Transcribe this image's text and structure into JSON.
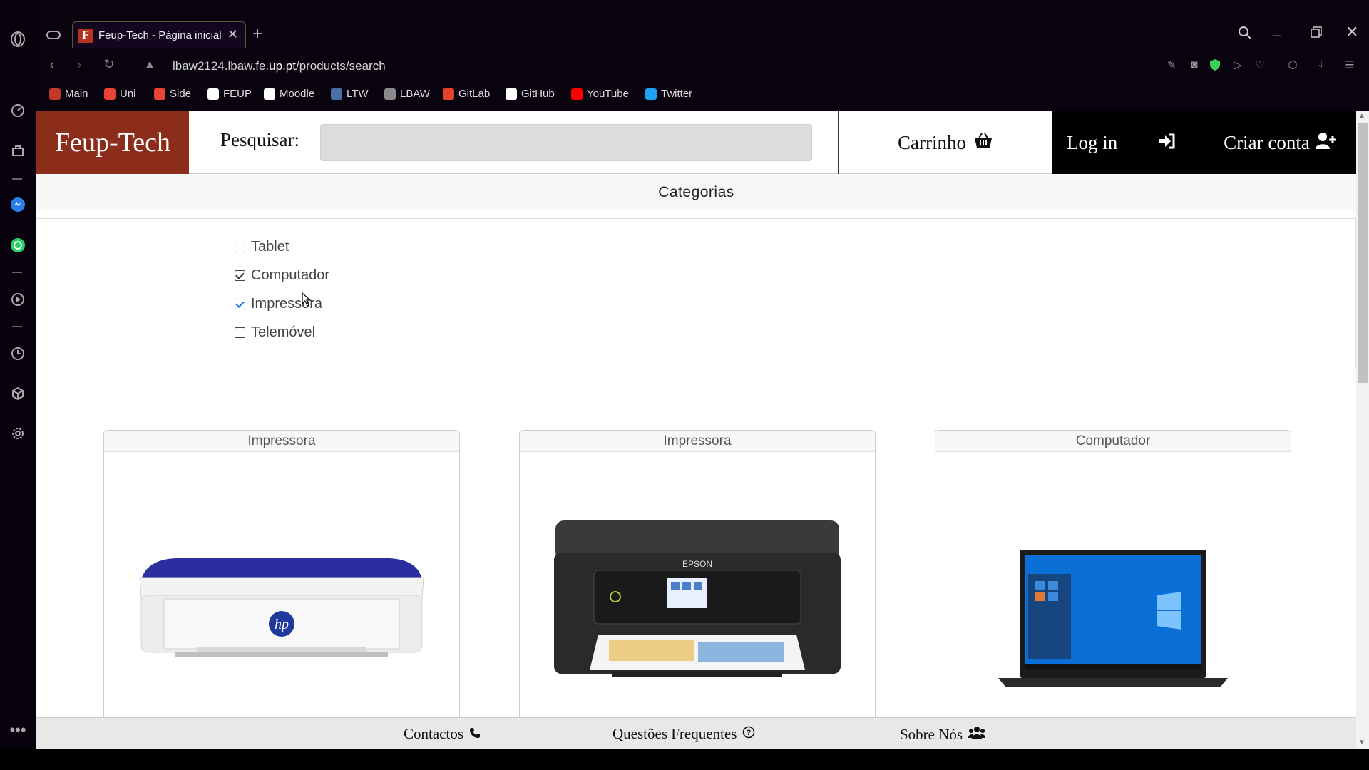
{
  "browser": {
    "tab_title": "Feup-Tech - Página inicial",
    "tab_favicon": "F",
    "url_prefix": "lbaw2124.lbaw.fe.",
    "url_domain": "up.pt",
    "url_path": "/products/search",
    "bookmarks": [
      {
        "label": "Main",
        "color": "#c0392b"
      },
      {
        "label": "Uni",
        "color": "#ea4335"
      },
      {
        "label": "Side",
        "color": "#ea4335"
      },
      {
        "label": "FEUP",
        "color": "#ffffff"
      },
      {
        "label": "Moodle",
        "color": "#ffffff"
      },
      {
        "label": "LTW",
        "color": "#4a6fa5"
      },
      {
        "label": "LBAW",
        "color": "#8a8a8a"
      },
      {
        "label": "GitLab",
        "color": "#e24329"
      },
      {
        "label": "GitHub",
        "color": "#ffffff"
      },
      {
        "label": "YouTube",
        "color": "#ff0000"
      },
      {
        "label": "Twitter",
        "color": "#1da1f2"
      }
    ]
  },
  "header": {
    "logo": "Feup-Tech",
    "search_label": "Pesquisar:",
    "search_value": "",
    "cart_label": "Carrinho",
    "login_label": "Log in",
    "signup_label": "Criar conta"
  },
  "categories": {
    "title": "Categorias",
    "items": [
      {
        "label": "Tablet",
        "checked": false
      },
      {
        "label": "Computador",
        "checked": true
      },
      {
        "label": "Impressora",
        "checked": true
      },
      {
        "label": "Telemóvel",
        "checked": false
      }
    ]
  },
  "products": [
    {
      "category": "Impressora",
      "image": "hp-printer"
    },
    {
      "category": "Impressora",
      "image": "epson-printer"
    },
    {
      "category": "Computador",
      "image": "laptop"
    }
  ],
  "footer": {
    "contacts": "Contactos",
    "faq": "Questões Frequentes",
    "about": "Sobre Nós"
  },
  "colors": {
    "brand": "#8c2c1a",
    "dark": "#000000"
  }
}
